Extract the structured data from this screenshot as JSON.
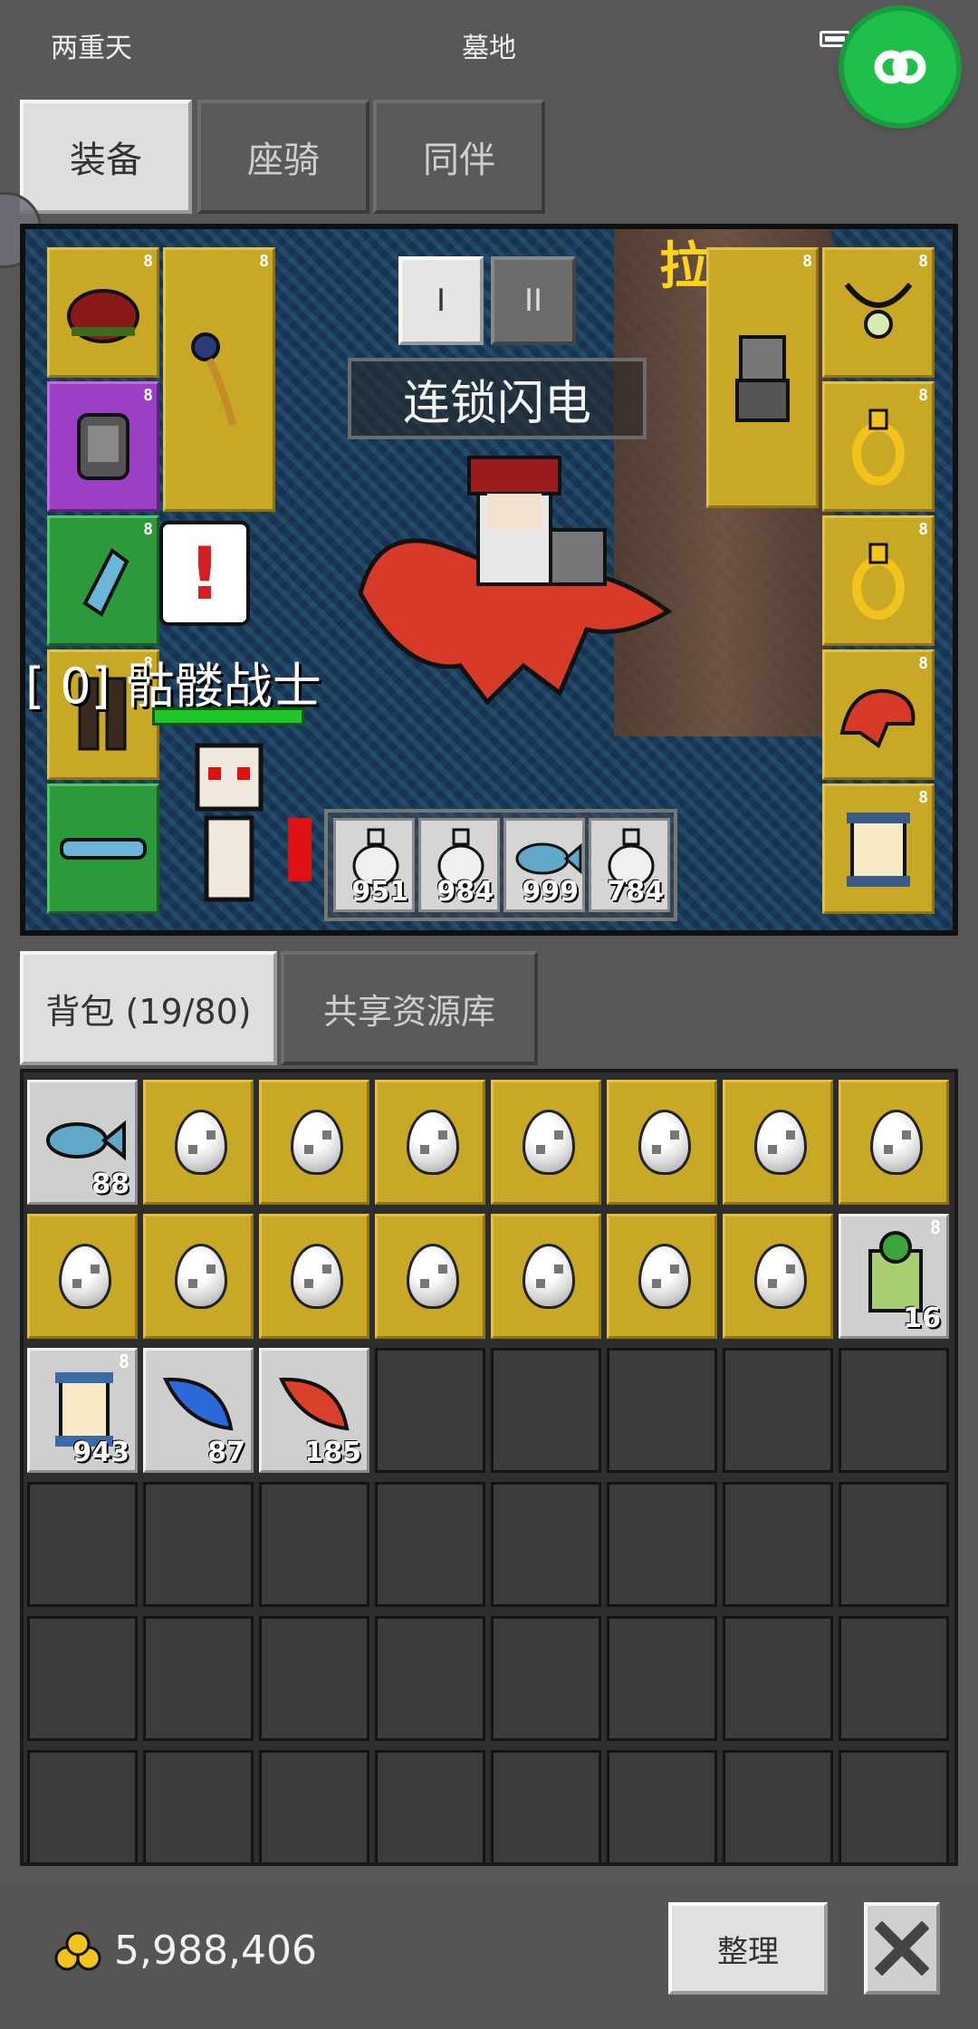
{
  "status_bar": {
    "left_text": "两重天",
    "center_text": "墓地"
  },
  "top_tabs": [
    {
      "label": "装备",
      "active": true
    },
    {
      "label": "座骑",
      "active": false
    },
    {
      "label": "同伴",
      "active": false
    }
  ],
  "scene": {
    "page_buttons": [
      "I",
      "II"
    ],
    "skill_name": "连锁闪电",
    "npc_name": "拉",
    "enemy_label": "[ 0] 骷髅战士",
    "quickbar": [
      {
        "item": "potion",
        "count": "951"
      },
      {
        "item": "potion",
        "count": "984"
      },
      {
        "item": "fish",
        "count": "999"
      },
      {
        "item": "potion",
        "count": "784"
      }
    ],
    "lock_glyph": "8",
    "left_slots": [
      {
        "name": "helmet",
        "tier": "gold"
      },
      {
        "name": "armor",
        "tier": "purple"
      },
      {
        "name": "gloves",
        "tier": "green"
      },
      {
        "name": "boots",
        "tier": "gold"
      },
      {
        "name": "belt",
        "tier": "green"
      }
    ],
    "right_slots": [
      {
        "name": "necklace",
        "tier": "gold"
      },
      {
        "name": "ring",
        "tier": "gold"
      },
      {
        "name": "ring",
        "tier": "gold"
      },
      {
        "name": "mount-dragon",
        "tier": "gold"
      },
      {
        "name": "scroll",
        "tier": "gold"
      }
    ]
  },
  "inventory": {
    "tabs": [
      {
        "label": "背包 (19/80)",
        "active": true
      },
      {
        "label": "共享资源库",
        "active": false
      }
    ],
    "slots": [
      {
        "item": "fish",
        "count": "88",
        "bg": "light"
      },
      {
        "item": "egg",
        "bg": "gold"
      },
      {
        "item": "egg",
        "bg": "gold"
      },
      {
        "item": "egg",
        "bg": "gold"
      },
      {
        "item": "egg",
        "bg": "gold"
      },
      {
        "item": "egg",
        "bg": "gold"
      },
      {
        "item": "egg",
        "bg": "gold"
      },
      {
        "item": "egg",
        "bg": "gold"
      },
      {
        "item": "egg",
        "bg": "gold"
      },
      {
        "item": "egg",
        "bg": "gold"
      },
      {
        "item": "egg",
        "bg": "gold"
      },
      {
        "item": "egg",
        "bg": "gold"
      },
      {
        "item": "egg",
        "bg": "gold"
      },
      {
        "item": "egg",
        "bg": "gold"
      },
      {
        "item": "egg",
        "bg": "gold"
      },
      {
        "item": "green-scroll",
        "count": "16",
        "bg": "light",
        "locked": true
      },
      {
        "item": "scroll",
        "count": "943",
        "bg": "light",
        "locked": true
      },
      {
        "item": "blue-feather",
        "count": "87",
        "bg": "light"
      },
      {
        "item": "red-feather",
        "count": "185",
        "bg": "light"
      }
    ],
    "rows": 6,
    "cols": 8
  },
  "footer": {
    "gold_amount": "5,988,406",
    "sort_label": "整理"
  },
  "colors": {
    "gold_slot": "#c9a825",
    "green_slot": "#2c9a3a",
    "purple_slot": "#9b3fc4",
    "link_button": "#1fbf4b",
    "npc_name": "#ffd21d"
  }
}
